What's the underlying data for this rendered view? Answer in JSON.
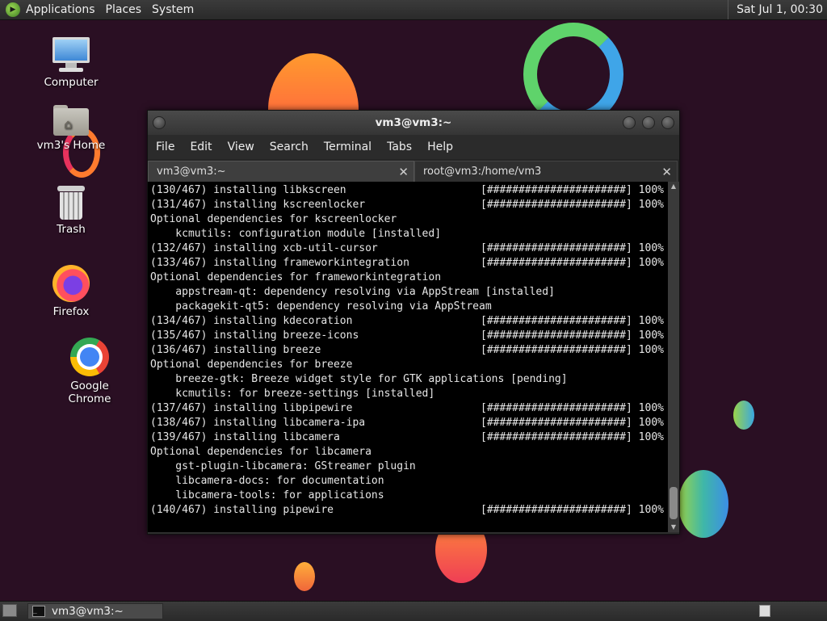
{
  "top_panel": {
    "menus": [
      "Applications",
      "Places",
      "System"
    ],
    "clock": "Sat Jul  1, 00:30"
  },
  "desktop_icons": [
    {
      "label": "Computer",
      "icon": "computer-icon"
    },
    {
      "label": "vm3's Home",
      "icon": "home-folder-icon"
    },
    {
      "label": "Trash",
      "icon": "trash-icon"
    },
    {
      "label": "Firefox",
      "icon": "firefox-icon"
    },
    {
      "label": "Google Chrome",
      "icon": "chrome-icon"
    }
  ],
  "window": {
    "title": "vm3@vm3:~",
    "menu": [
      "File",
      "Edit",
      "View",
      "Search",
      "Terminal",
      "Tabs",
      "Help"
    ],
    "tabs": [
      {
        "label": "vm3@vm3:~",
        "close": "✕"
      },
      {
        "label": "root@vm3:/home/vm3",
        "close": "✕"
      }
    ]
  },
  "terminal": {
    "lines": [
      {
        "text": "(130/467) installing libkscreen",
        "bar": "[######################] 100%"
      },
      {
        "text": "(131/467) installing kscreenlocker",
        "bar": "[######################] 100%"
      },
      {
        "text": "Optional dependencies for kscreenlocker",
        "bar": ""
      },
      {
        "text": "    kcmutils: configuration module [installed]",
        "bar": ""
      },
      {
        "text": "(132/467) installing xcb-util-cursor",
        "bar": "[######################] 100%"
      },
      {
        "text": "(133/467) installing frameworkintegration",
        "bar": "[######################] 100%"
      },
      {
        "text": "Optional dependencies for frameworkintegration",
        "bar": ""
      },
      {
        "text": "    appstream-qt: dependency resolving via AppStream [installed]",
        "bar": ""
      },
      {
        "text": "    packagekit-qt5: dependency resolving via AppStream",
        "bar": ""
      },
      {
        "text": "(134/467) installing kdecoration",
        "bar": "[######################] 100%"
      },
      {
        "text": "(135/467) installing breeze-icons",
        "bar": "[######################] 100%"
      },
      {
        "text": "(136/467) installing breeze",
        "bar": "[######################] 100%"
      },
      {
        "text": "Optional dependencies for breeze",
        "bar": ""
      },
      {
        "text": "    breeze-gtk: Breeze widget style for GTK applications [pending]",
        "bar": ""
      },
      {
        "text": "    kcmutils: for breeze-settings [installed]",
        "bar": ""
      },
      {
        "text": "(137/467) installing libpipewire",
        "bar": "[######################] 100%"
      },
      {
        "text": "(138/467) installing libcamera-ipa",
        "bar": "[######################] 100%"
      },
      {
        "text": "(139/467) installing libcamera",
        "bar": "[######################] 100%"
      },
      {
        "text": "Optional dependencies for libcamera",
        "bar": ""
      },
      {
        "text": "    gst-plugin-libcamera: GStreamer plugin",
        "bar": ""
      },
      {
        "text": "    libcamera-docs: for documentation",
        "bar": ""
      },
      {
        "text": "    libcamera-tools: for applications",
        "bar": ""
      },
      {
        "text": "(140/467) installing pipewire",
        "bar": "[######################] 100%"
      }
    ]
  },
  "bottom_panel": {
    "task": "vm3@vm3:~"
  }
}
